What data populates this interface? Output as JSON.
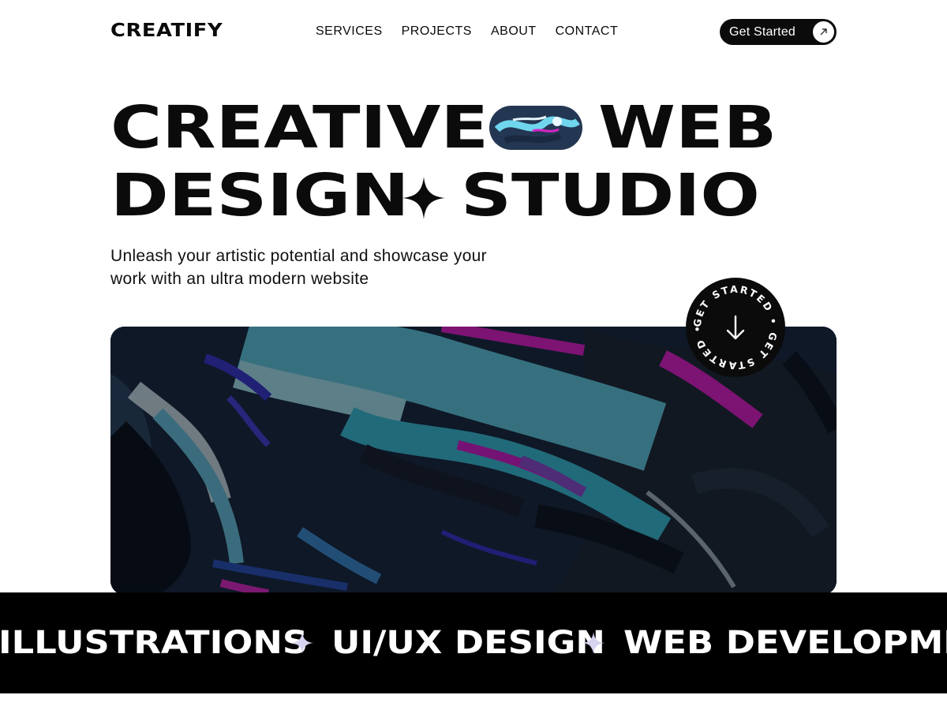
{
  "brand": {
    "name": "CREATIFY"
  },
  "nav": {
    "links": [
      "SERVICES",
      "PROJECTS",
      "ABOUT",
      "CONTACT"
    ],
    "cta_label": "Get Started",
    "cta_icon": "arrow-up-right-icon"
  },
  "hero": {
    "line1": {
      "word1": "CREATIVE",
      "word2": "WEB"
    },
    "line2": {
      "word1": "DESIGN",
      "word2": "STUDIO"
    },
    "subtitle_line1": "Unleash your artistic potential and showcase your",
    "subtitle_line2": "work with an ultra modern website"
  },
  "badge": {
    "ring_text": "GET STARTED • GET STARTED •",
    "icon": "arrow-down-icon"
  },
  "ticker": {
    "items": [
      "ILLUSTRATIONS",
      "UI/UX DESIGN",
      "WEB DEVELOPMEN"
    ],
    "separator_icon": "sparkle-icon"
  },
  "colors": {
    "ink": "#0b0b0b",
    "background": "#ffffff",
    "accent_cyan": "#5fd3ea",
    "accent_magenta": "#e11fd6",
    "accent_blue": "#3a3ad8",
    "ticker_star": "#d6d4f0"
  }
}
